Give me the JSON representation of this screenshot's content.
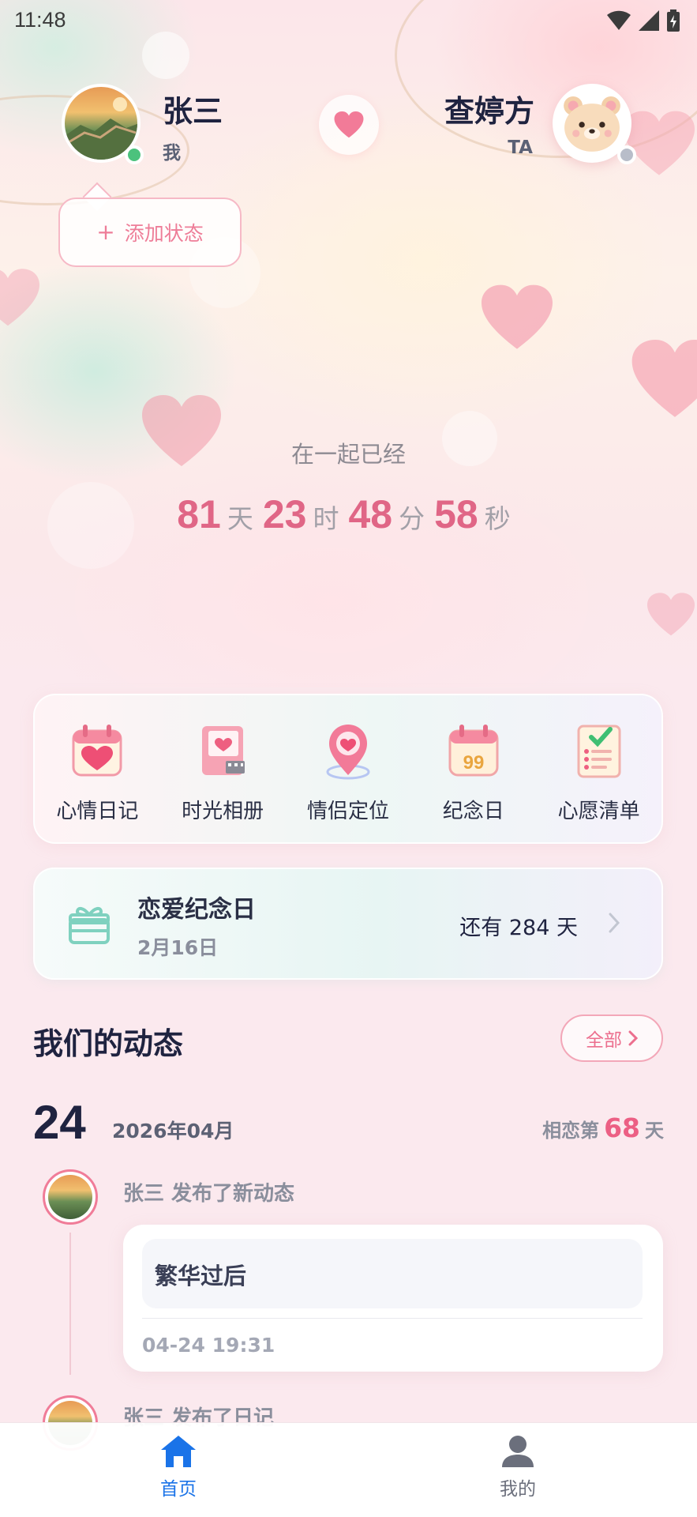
{
  "status_bar": {
    "time": "11:48"
  },
  "profile": {
    "me": {
      "name": "张三",
      "role": "我"
    },
    "ta": {
      "name": "查婷方",
      "role": "TA"
    },
    "add_status_label": "添加状态"
  },
  "together": {
    "label": "在一起已经",
    "days": "81",
    "days_unit": "天",
    "hours": "23",
    "hours_unit": "时",
    "minutes": "48",
    "minutes_unit": "分",
    "seconds": "58",
    "seconds_unit": "秒"
  },
  "features": [
    {
      "label": "心情日记",
      "icon": "mood-diary-icon"
    },
    {
      "label": "时光相册",
      "icon": "photo-album-icon"
    },
    {
      "label": "情侣定位",
      "icon": "location-pin-icon"
    },
    {
      "label": "纪念日",
      "icon": "anniversary-calendar-icon"
    },
    {
      "label": "心愿清单",
      "icon": "wishlist-checklist-icon"
    }
  ],
  "anniversary": {
    "title": "恋爱纪念日",
    "date": "2月16日",
    "remaining": "还有 284 天"
  },
  "feed": {
    "section_title": "我们的动态",
    "all_label": "全部",
    "date_day": "24",
    "date_year_month": "2026年04月",
    "love_days_prefix": "相恋第",
    "love_days_value": "68",
    "love_days_suffix": "天",
    "items": [
      {
        "action": "张三 发布了新动态",
        "content": "繁华过后",
        "time": "04-24 19:31"
      },
      {
        "action": "张三 发布了日记"
      }
    ]
  },
  "tabs": [
    {
      "label": "首页",
      "active": true
    },
    {
      "label": "我的",
      "active": false
    }
  ],
  "colors": {
    "accent_pink": "#e06686",
    "tab_active": "#1a73e8",
    "tab_inactive": "#6b6f7c",
    "online": "#4cc27d",
    "offline": "#b8bdc9"
  }
}
